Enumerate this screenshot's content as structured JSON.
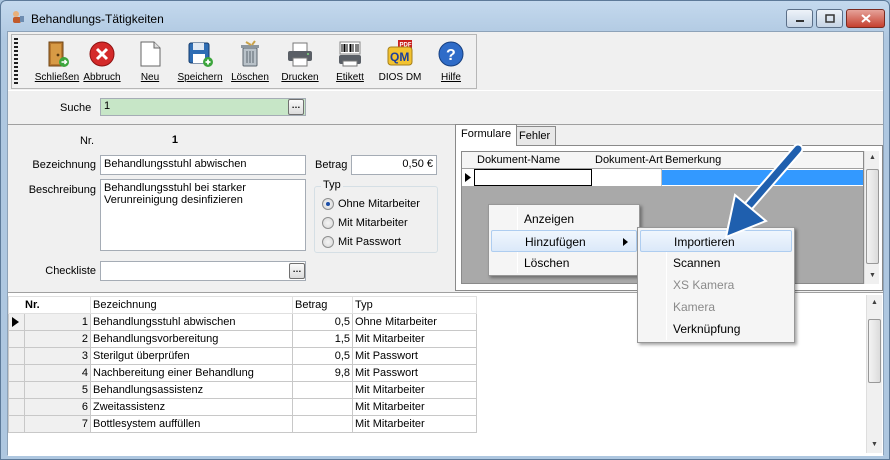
{
  "window": {
    "title": "Behandlungs-Tätigkeiten",
    "minimize_icon": "minimize-icon",
    "maximize_icon": "maximize-icon",
    "close_icon": "close-icon"
  },
  "toolbar": {
    "buttons": [
      {
        "label": "Schließen",
        "icon": "exit-door-icon"
      },
      {
        "label": "Abbruch",
        "icon": "cancel-icon"
      },
      {
        "label": "Neu",
        "icon": "new-document-icon"
      },
      {
        "label": "Speichern",
        "icon": "save-icon"
      },
      {
        "label": "Löschen",
        "icon": "trash-icon"
      },
      {
        "label": "Drucken",
        "icon": "printer-icon"
      },
      {
        "label": "Etikett",
        "icon": "barcode-label-icon"
      },
      {
        "label": "DIOS DM",
        "icon": "dios-dm-icon"
      },
      {
        "label": "Hilfe",
        "icon": "help-icon"
      }
    ]
  },
  "search": {
    "label": "Suche",
    "value": "1"
  },
  "form": {
    "nr_label": "Nr.",
    "nr_value": "1",
    "bezeichnung_label": "Bezeichnung",
    "bezeichnung_value": "Behandlungsstuhl abwischen",
    "betrag_label": "Betrag",
    "betrag_value": "0,50 €",
    "beschreibung_label": "Beschreibung",
    "beschreibung_line1": "Behandlungsstuhl bei starker",
    "beschreibung_line2": "Verunreinigung desinfizieren",
    "typ_label": "Typ",
    "typ_options": [
      "Ohne Mitarbeiter",
      "Mit Mitarbeiter",
      "Mit Passwort"
    ],
    "typ_selected": "Ohne Mitarbeiter",
    "checkliste_label": "Checkliste",
    "checkliste_value": ""
  },
  "tabs": {
    "items": [
      "Formulare",
      "Fehler"
    ],
    "active": "Formulare",
    "columns": [
      "Dokument-Name",
      "Dokument-Art",
      "Bemerkung"
    ]
  },
  "context_menu": {
    "items": [
      "Anzeigen",
      "Hinzufügen",
      "Löschen"
    ],
    "highlighted": "Hinzufügen"
  },
  "submenu": {
    "items": [
      "Importieren",
      "Scannen",
      "XS Kamera",
      "Kamera",
      "Verknüpfung"
    ],
    "disabled": [
      "XS Kamera",
      "Kamera"
    ],
    "highlighted": "Importieren"
  },
  "annotation": {
    "arrow_color": "#1f5fae"
  },
  "table": {
    "headers": [
      "Nr.",
      "Bezeichnung",
      "Betrag",
      "Typ"
    ],
    "rows": [
      [
        "1",
        "Behandlungsstuhl abwischen",
        "0,5",
        "Ohne Mitarbeiter"
      ],
      [
        "2",
        "Behandlungsvorbereitung",
        "1,5",
        "Mit Mitarbeiter"
      ],
      [
        "3",
        "Sterilgut überprüfen",
        "0,5",
        "Mit Passwort"
      ],
      [
        "4",
        "Nachbereitung einer Behandlung",
        "9,8",
        "Mit Passwort"
      ],
      [
        "5",
        "Behandlungsassistenz",
        "",
        "Mit Mitarbeiter"
      ],
      [
        "6",
        "Zweitassistenz",
        "",
        "Mit Mitarbeiter"
      ],
      [
        "7",
        "Bottlesystem auffüllen",
        "",
        "Mit Mitarbeiter"
      ]
    ]
  },
  "colors": {
    "search_bg": "#c7e6c7",
    "selection": "#3399ff",
    "arrow": "#1f5fae"
  }
}
